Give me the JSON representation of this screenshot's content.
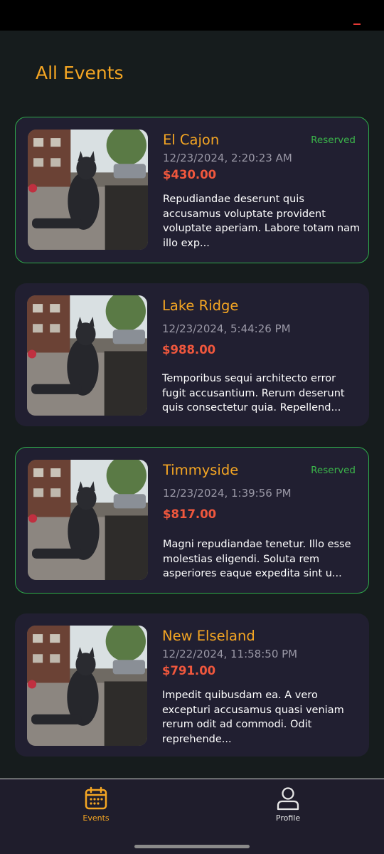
{
  "page": {
    "title": "All Events"
  },
  "events": [
    {
      "title": "El Cajon",
      "date": "12/23/2024, 2:20:23 AM",
      "price": "$430.00",
      "description": "Repudiandae deserunt quis accusamus voluptate provident voluptate aperiam. Labore totam nam illo exp...",
      "badge": "Reserved"
    },
    {
      "title": "Lake Ridge",
      "date": "12/23/2024, 5:44:26 PM",
      "price": "$988.00",
      "description": "Temporibus sequi architecto error fugit accusantium. Rerum deserunt quis consectetur quia. Repellend..."
    },
    {
      "title": "Timmyside",
      "date": "12/23/2024, 1:39:56 PM",
      "price": "$817.00",
      "description": "Magni repudiandae tenetur. Illo esse molestias eligendi. Soluta rem asperiores eaque expedita sint u...",
      "badge": "Reserved"
    },
    {
      "title": "New Elseland",
      "date": "12/22/2024, 11:58:50 PM",
      "price": "$791.00",
      "description": "Impedit quibusdam ea. A vero excepturi accusamus quasi veniam rerum odit ad commodi. Odit reprehende..."
    }
  ],
  "nav": {
    "items": [
      {
        "label": "Events",
        "icon": "calendar-icon",
        "active": true
      },
      {
        "label": "Profile",
        "icon": "user-icon",
        "active": false
      }
    ]
  },
  "colors": {
    "accent": "#f5a623",
    "price": "#f0573d",
    "reserved": "#3bb54a",
    "card_bg": "#211f31",
    "page_bg": "#161c1d"
  }
}
